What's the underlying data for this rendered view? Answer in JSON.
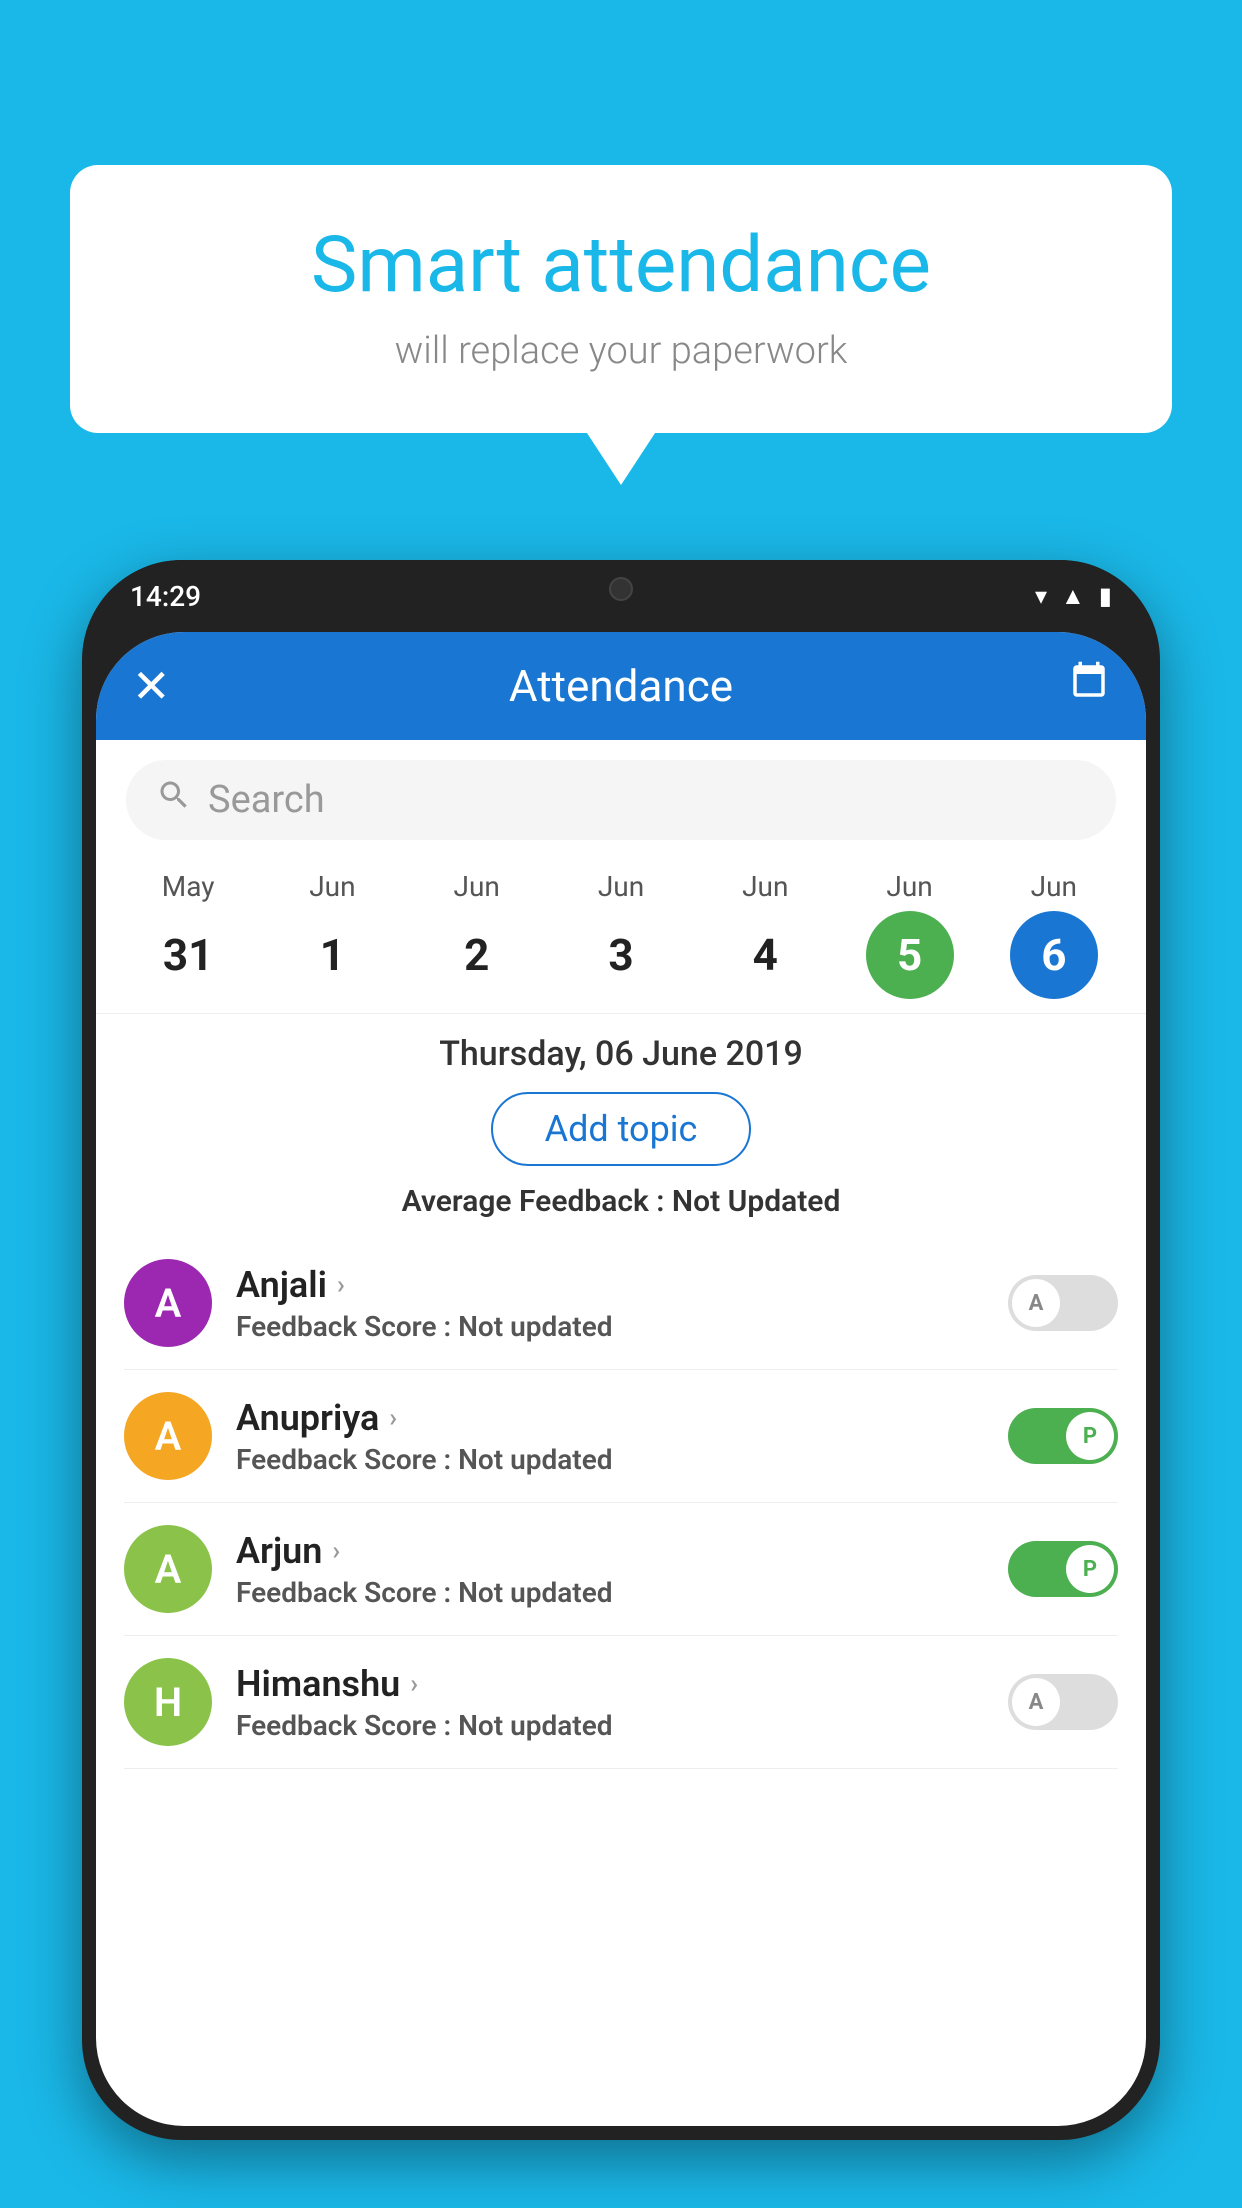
{
  "background_color": "#1ab8e8",
  "bubble": {
    "title": "Smart attendance",
    "subtitle": "will replace your paperwork"
  },
  "phone": {
    "status_bar": {
      "time": "14:29"
    },
    "header": {
      "title": "Attendance",
      "close_label": "✕"
    },
    "search": {
      "placeholder": "Search"
    },
    "calendar": {
      "months": [
        "May",
        "Jun",
        "Jun",
        "Jun",
        "Jun",
        "Jun",
        "Jun"
      ],
      "dates": [
        "31",
        "1",
        "2",
        "3",
        "4",
        "5",
        "6"
      ],
      "today_index": 5,
      "selected_index": 6
    },
    "selected_date": {
      "label": "Thursday, 06 June 2019",
      "add_topic_btn": "Add topic",
      "avg_feedback_label": "Average Feedback :",
      "avg_feedback_value": "Not Updated"
    },
    "students": [
      {
        "name": "Anjali",
        "initial": "A",
        "avatar_color": "#9c27b0",
        "feedback_label": "Feedback Score :",
        "feedback_value": "Not updated",
        "attendance": "absent"
      },
      {
        "name": "Anupriya",
        "initial": "A",
        "avatar_color": "#f5a623",
        "feedback_label": "Feedback Score :",
        "feedback_value": "Not updated",
        "attendance": "present"
      },
      {
        "name": "Arjun",
        "initial": "A",
        "avatar_color": "#8bc34a",
        "feedback_label": "Feedback Score :",
        "feedback_value": "Not updated",
        "attendance": "present"
      },
      {
        "name": "Himanshu",
        "initial": "H",
        "avatar_color": "#8bc34a",
        "feedback_label": "Feedback Score :",
        "feedback_value": "Not updated",
        "attendance": "absent"
      }
    ]
  }
}
